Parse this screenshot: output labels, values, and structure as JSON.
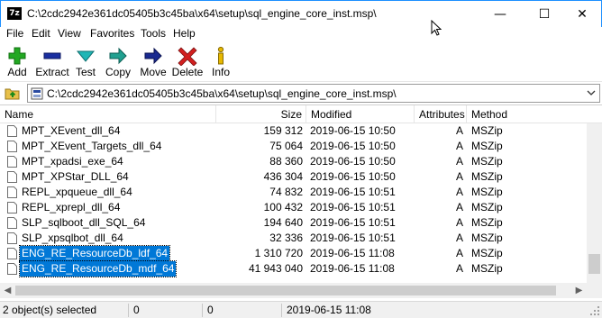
{
  "window": {
    "app_icon_text": "7z",
    "title": "C:\\2cdc2942e361dc05405b3c45ba\\x64\\setup\\sql_engine_core_inst.msp\\",
    "controls": {
      "minimize": "—",
      "maximize": "☐",
      "close": "✕"
    }
  },
  "menu": [
    "File",
    "Edit",
    "View",
    "Favorites",
    "Tools",
    "Help"
  ],
  "toolbar": [
    {
      "label": "Add",
      "icon": "add-icon",
      "color": "#22a822"
    },
    {
      "label": "Extract",
      "icon": "extract-icon",
      "color": "#1a2fa0"
    },
    {
      "label": "Test",
      "icon": "test-icon",
      "color": "#20b6b6"
    },
    {
      "label": "Copy",
      "icon": "copy-icon",
      "color": "#20a090"
    },
    {
      "label": "Move",
      "icon": "move-icon",
      "color": "#1a2a90"
    },
    {
      "label": "Delete",
      "icon": "delete-icon",
      "color": "#d22020"
    },
    {
      "label": "Info",
      "icon": "info-icon",
      "color": "#e6b800"
    }
  ],
  "address": {
    "path": "C:\\2cdc2942e361dc05405b3c45ba\\x64\\setup\\sql_engine_core_inst.msp\\"
  },
  "columns": [
    "Name",
    "Size",
    "Modified",
    "Attributes",
    "Method"
  ],
  "files": [
    {
      "name": "MPT_XEvent_dll_64",
      "size": "159 312",
      "modified": "2019-06-15 10:50",
      "attributes": "A",
      "method": "MSZip",
      "selected": false
    },
    {
      "name": "MPT_XEvent_Targets_dll_64",
      "size": "75 064",
      "modified": "2019-06-15 10:50",
      "attributes": "A",
      "method": "MSZip",
      "selected": false
    },
    {
      "name": "MPT_xpadsi_exe_64",
      "size": "88 360",
      "modified": "2019-06-15 10:50",
      "attributes": "A",
      "method": "MSZip",
      "selected": false
    },
    {
      "name": "MPT_XPStar_DLL_64",
      "size": "436 304",
      "modified": "2019-06-15 10:50",
      "attributes": "A",
      "method": "MSZip",
      "selected": false
    },
    {
      "name": "REPL_xpqueue_dll_64",
      "size": "74 832",
      "modified": "2019-06-15 10:51",
      "attributes": "A",
      "method": "MSZip",
      "selected": false
    },
    {
      "name": "REPL_xprepl_dll_64",
      "size": "100 432",
      "modified": "2019-06-15 10:51",
      "attributes": "A",
      "method": "MSZip",
      "selected": false
    },
    {
      "name": "SLP_sqlboot_dll_SQL_64",
      "size": "194 640",
      "modified": "2019-06-15 10:51",
      "attributes": "A",
      "method": "MSZip",
      "selected": false
    },
    {
      "name": "SLP_xpsqlbot_dll_64",
      "size": "32 336",
      "modified": "2019-06-15 10:51",
      "attributes": "A",
      "method": "MSZip",
      "selected": false
    },
    {
      "name": "ENG_RE_ResourceDb_ldf_64",
      "size": "1 310 720",
      "modified": "2019-06-15 11:08",
      "attributes": "A",
      "method": "MSZip",
      "selected": true
    },
    {
      "name": "ENG_RE_ResourceDb_mdf_64",
      "size": "41 943 040",
      "modified": "2019-06-15 11:08",
      "attributes": "A",
      "method": "MSZip",
      "selected": true
    }
  ],
  "status": {
    "selection": "2 object(s) selected",
    "field2": "0",
    "field3": "0",
    "modified": "2019-06-15 11:08"
  },
  "colors": {
    "selection": "#0078d7",
    "window_border": "#1e90ff"
  }
}
